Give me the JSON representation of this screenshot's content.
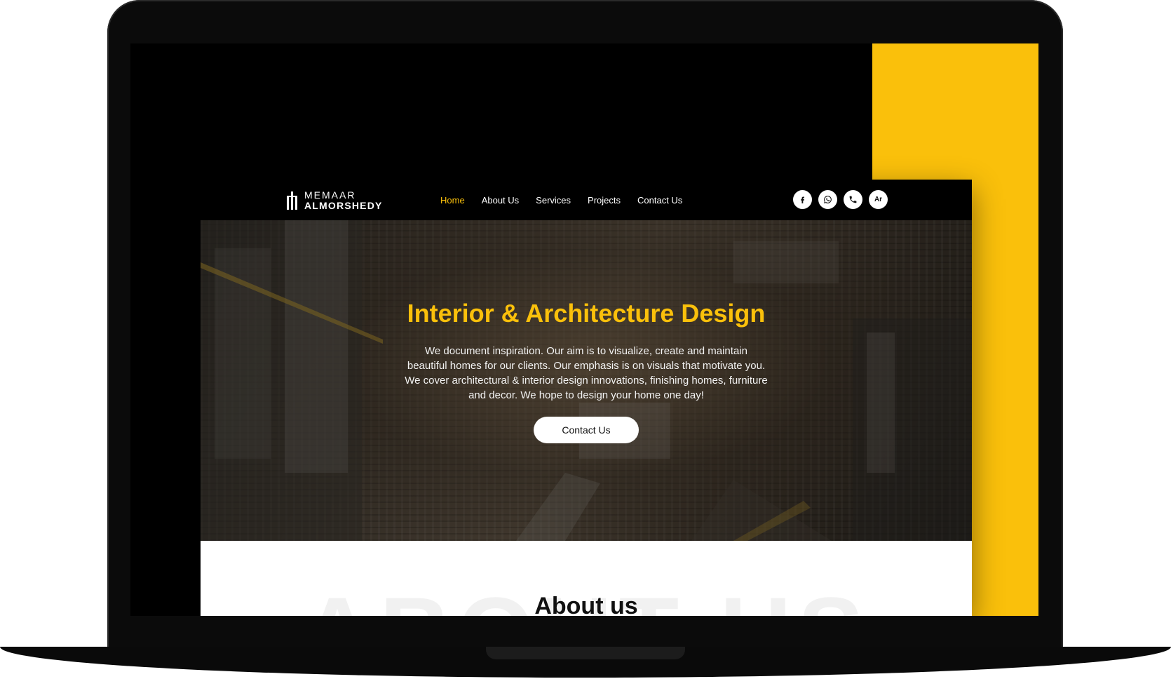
{
  "brand": {
    "line1": "MEMAAR",
    "line2": "ALMORSHEDY",
    "accent_color": "#fac00b"
  },
  "nav": {
    "links": [
      {
        "label": "Home",
        "active": true
      },
      {
        "label": "About Us",
        "active": false
      },
      {
        "label": "Services",
        "active": false
      },
      {
        "label": "Projects",
        "active": false
      },
      {
        "label": "Contact Us",
        "active": false
      }
    ],
    "icons": [
      {
        "name": "facebook-icon"
      },
      {
        "name": "whatsapp-icon"
      },
      {
        "name": "phone-icon"
      },
      {
        "name": "language-toggle",
        "label": "Ar"
      }
    ]
  },
  "hero": {
    "title": "Interior & Architecture Design",
    "text": "We document inspiration. Our aim is to visualize, create and maintain beautiful homes for our clients. Our emphasis is on visuals that motivate you. We cover architectural & interior design innovations, finishing homes, furniture and decor. We hope to design your home one day!",
    "button_label": "Contact Us"
  },
  "about": {
    "title": "About us",
    "background_word": "ABOUT US"
  }
}
